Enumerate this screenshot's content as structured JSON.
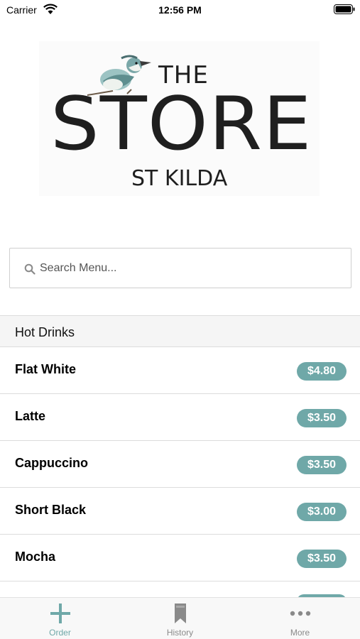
{
  "status_bar": {
    "carrier": "Carrier",
    "time": "12:56 PM"
  },
  "logo": {
    "line1": "THE",
    "line2": "STORE",
    "line3": "ST KILDA"
  },
  "search": {
    "placeholder": "Search Menu...",
    "value": ""
  },
  "section": {
    "title": "Hot Drinks"
  },
  "menu": {
    "items": [
      {
        "name": "Flat White",
        "price": "$4.80"
      },
      {
        "name": "Latte",
        "price": "$3.50"
      },
      {
        "name": "Cappuccino",
        "price": "$3.50"
      },
      {
        "name": "Short Black",
        "price": "$3.00"
      },
      {
        "name": "Mocha",
        "price": "$3.50"
      }
    ]
  },
  "tab_bar": {
    "tabs": [
      {
        "label": "Order",
        "icon": "plus-icon",
        "active": true
      },
      {
        "label": "History",
        "icon": "bookmark-icon",
        "active": false
      },
      {
        "label": "More",
        "icon": "more-dots-icon",
        "active": false
      }
    ]
  },
  "colors": {
    "accent": "#6fa8a8",
    "inactive_tab": "#8a8a8a"
  }
}
